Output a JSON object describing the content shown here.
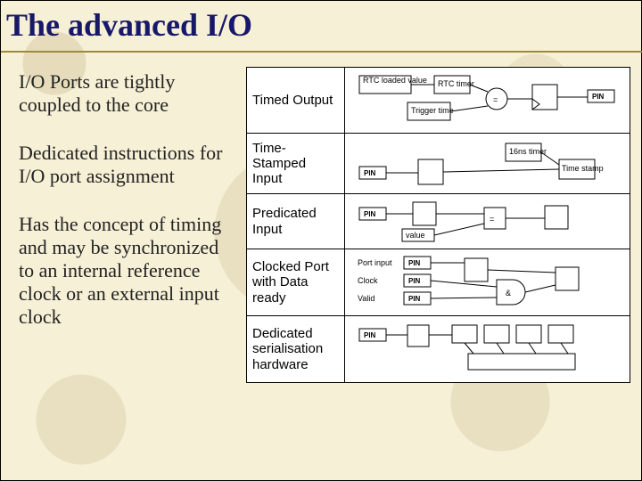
{
  "title": "The advanced I/O",
  "bullets": [
    "I/O Ports are tightly coupled to the core",
    "Dedicated instructions for I/O port assignment",
    "Has the concept of timing and may be synchronized to an internal reference clock or an external input clock"
  ],
  "table": {
    "rows": [
      {
        "label": "Timed Output",
        "diagram_name": "diagram-timed-output"
      },
      {
        "label": "Time-Stamped Input",
        "diagram_name": "diagram-time-stamped-input"
      },
      {
        "label": "Predicated Input",
        "diagram_name": "diagram-predicated-input"
      },
      {
        "label": "Clocked Port with Data ready",
        "diagram_name": "diagram-clocked-port"
      },
      {
        "label": "Dedicated serialisation hardware",
        "diagram_name": "diagram-serialisation"
      }
    ]
  },
  "diagram_labels": {
    "timed_output": {
      "rtc_loaded_value": "RTC loaded value",
      "rtc_timer": "RTC timer",
      "trigger_time": "Trigger time",
      "pin": "PIN"
    },
    "time_stamped": {
      "timer_16ns": "16ns timer",
      "time_stamp": "Time stamp",
      "pin": "PIN"
    },
    "predicated": {
      "value": "value",
      "pin": "PIN"
    },
    "clocked_port": {
      "port_input": "Port input",
      "clock": "Clock",
      "valid": "Valid",
      "pin": "PIN",
      "amp": "&"
    },
    "serialisation": {
      "pin": "PIN"
    }
  }
}
